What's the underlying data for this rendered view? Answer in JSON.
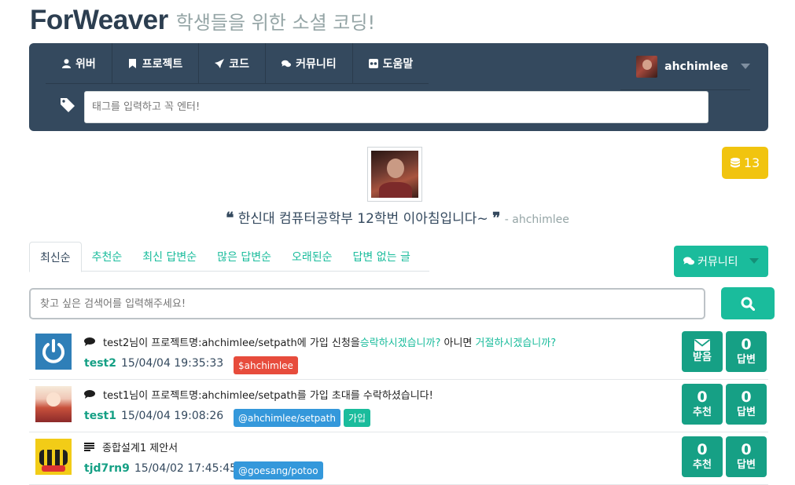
{
  "brand": {
    "name": "ForWeaver",
    "tagline": "학생들을 위한 소셜 코딩!"
  },
  "nav": {
    "items": [
      {
        "label": "위버",
        "icon": "user-icon"
      },
      {
        "label": "프로젝트",
        "icon": "bookmark-icon"
      },
      {
        "label": "코드",
        "icon": "rocket-icon"
      },
      {
        "label": "커뮤니티",
        "icon": "comments-icon"
      },
      {
        "label": "도움말",
        "icon": "flickr-icon"
      }
    ],
    "user": {
      "name": "ahchimlee"
    },
    "tag_input": {
      "placeholder": "태그를 입력하고 꼭 엔터!"
    }
  },
  "coins": {
    "count": "13",
    "color": "#f1c40f"
  },
  "profile": {
    "quote": "한신대 컴퓨터공학부 12학번 이아침입니다~",
    "author": "- ahchimlee"
  },
  "tabs": [
    {
      "label": "최신순",
      "active": true
    },
    {
      "label": "추천순"
    },
    {
      "label": "최신 답변순"
    },
    {
      "label": "많은 답변순"
    },
    {
      "label": "오래된순"
    },
    {
      "label": "답변 없는 글"
    }
  ],
  "community_button": {
    "label": "커뮤니티"
  },
  "search": {
    "placeholder": "찾고 싶은 검색어를 입력해주세요!"
  },
  "posts": [
    {
      "title_prefix": "test2님이 프로젝트명:ahchimlee/setpath에 가입 신청을 ",
      "title_link1": "승락하시겠습니까?",
      "title_mid": " 아니면 ",
      "title_link2": "거절하시겠습니까?",
      "user": "test2",
      "date": "15/04/04 19:35:33",
      "labels": [
        "$ahchimlee"
      ],
      "stat1": {
        "value": "0",
        "label": "받음"
      },
      "stat2": {
        "value": "0",
        "label": "답변"
      }
    },
    {
      "title": "test1님이 프로젝트명:ahchimlee/setpath를 가입 초대를 수락하셨습니다!",
      "user": "test1",
      "date": "15/04/04 19:08:26",
      "labels": [
        "@ahchimlee/setpath",
        "가입"
      ],
      "stat1": {
        "value": "0",
        "label": "추천"
      },
      "stat2": {
        "value": "0",
        "label": "답변"
      }
    },
    {
      "title": "종합설계1 제안서",
      "user": "tjd7rn9",
      "date": "15/04/02 17:45:45",
      "labels": [
        "@goesang/potoo"
      ],
      "stat1": {
        "value": "0",
        "label": "추천"
      },
      "stat2": {
        "value": "0",
        "label": "답변"
      }
    }
  ],
  "colors": {
    "nav_bg": "#34495e",
    "accent": "#1abc9c",
    "label_red": "#e74c3c",
    "label_blue": "#3498db"
  }
}
